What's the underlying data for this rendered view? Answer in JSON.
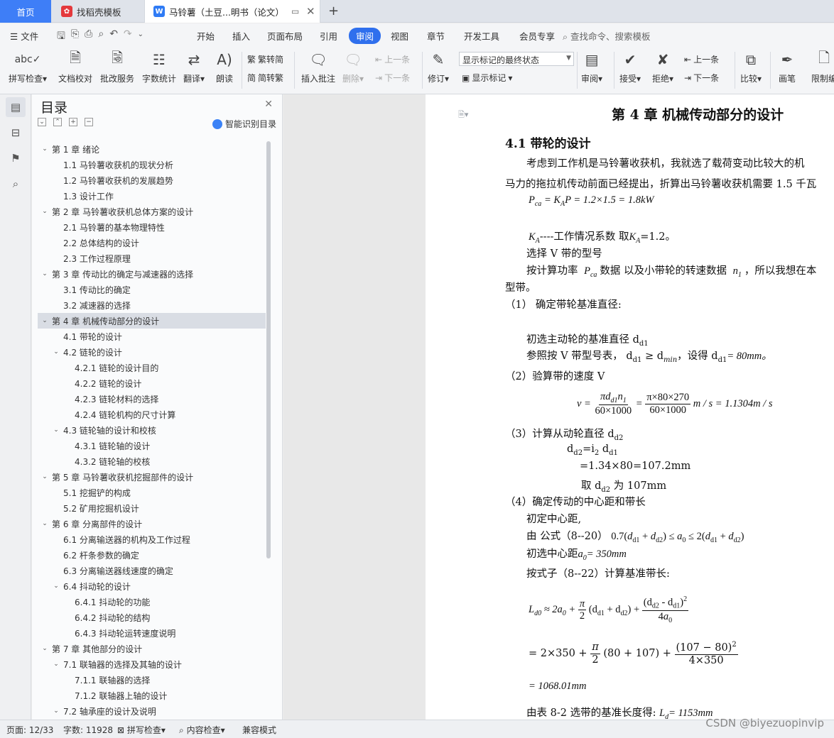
{
  "tabs": {
    "home": "首页",
    "template": "找稻壳模板",
    "document": "马铃薯（土豆...明书（论文）"
  },
  "menu": {
    "file": "文件",
    "items": [
      "开始",
      "插入",
      "页面布局",
      "引用",
      "审阅",
      "视图",
      "章节",
      "开发工具",
      "会员专享"
    ],
    "active": "审阅",
    "search": "查找命令、搜索模板"
  },
  "ribbon": {
    "spell_check": "拼写检查",
    "doc_proof": "文档校对",
    "annotate_service": "批改服务",
    "word_count": "字数统计",
    "translate": "翻译",
    "read_aloud": "朗读",
    "trad_simp": "繁转简",
    "simp_trad": "简转繁",
    "insert_comment": "插入批注",
    "delete": "删除",
    "prev": "上一条",
    "next": "下一条",
    "track": "修订",
    "markup_select": "显示标记的最终状态",
    "show_markup": "显示标记",
    "review": "审阅",
    "accept": "接受",
    "reject": "拒绝",
    "prev2": "上一条",
    "next2": "下一条",
    "compare": "比较",
    "pen": "画笔",
    "restrict": "限制编"
  },
  "outline": {
    "title": "目录",
    "smart": "智能识别目录",
    "items": [
      {
        "label": "第 1 章  绪论",
        "level": 1,
        "chev": "v"
      },
      {
        "label": "1.1 马铃薯收获机的现状分析",
        "level": 2,
        "chev": ""
      },
      {
        "label": "1.2  马铃薯收获机的发展趋势",
        "level": 2,
        "chev": ""
      },
      {
        "label": "1.3 设计工作",
        "level": 2,
        "chev": ""
      },
      {
        "label": "第 2 章   马铃薯收获机总体方案的设计",
        "level": 1,
        "chev": "v"
      },
      {
        "label": "2.1  马铃薯的基本物理特性",
        "level": 2,
        "chev": ""
      },
      {
        "label": "2.2  总体结构的设计",
        "level": 2,
        "chev": ""
      },
      {
        "label": "2.3  工作过程原理",
        "level": 2,
        "chev": ""
      },
      {
        "label": "第 3 章    传动比的确定与减速器的选择",
        "level": 1,
        "chev": "v"
      },
      {
        "label": "3.1  传动比的确定",
        "level": 2,
        "chev": ""
      },
      {
        "label": "3.2  减速器的选择",
        "level": 2,
        "chev": ""
      },
      {
        "label": "第 4 章  机械传动部分的设计",
        "level": 1,
        "chev": "v",
        "selected": true
      },
      {
        "label": "4.1  带轮的设计",
        "level": 2,
        "chev": ""
      },
      {
        "label": "4.2  链轮的设计",
        "level": 2,
        "chev": "v"
      },
      {
        "label": "4.2.1  链轮的设计目的",
        "level": 3,
        "chev": ""
      },
      {
        "label": "4.2.2  链轮的设计",
        "level": 3,
        "chev": ""
      },
      {
        "label": "4.2.3  链轮材料的选择",
        "level": 3,
        "chev": ""
      },
      {
        "label": "4.2.4  链轮机构的尺寸计算",
        "level": 3,
        "chev": ""
      },
      {
        "label": "4.3 链轮轴的设计和校核",
        "level": 2,
        "chev": "v"
      },
      {
        "label": "4.3.1  链轮轴的设计",
        "level": 3,
        "chev": ""
      },
      {
        "label": "4.3.2  链轮轴的校核",
        "level": 3,
        "chev": ""
      },
      {
        "label": "第 5 章  马铃薯收获机挖掘部件的设计",
        "level": 1,
        "chev": "v"
      },
      {
        "label": "5.1  挖掘铲的构成",
        "level": 2,
        "chev": ""
      },
      {
        "label": "5.2  矿用挖掘机设计",
        "level": 2,
        "chev": ""
      },
      {
        "label": "第 6 章  分离部件的设计",
        "level": 1,
        "chev": "v"
      },
      {
        "label": "6.1  分离输送器的机构及工作过程",
        "level": 2,
        "chev": ""
      },
      {
        "label": "6.2  杆条参数的确定",
        "level": 2,
        "chev": ""
      },
      {
        "label": "6.3  分离输送器线速度的确定",
        "level": 2,
        "chev": ""
      },
      {
        "label": "6.4  抖动轮的设计",
        "level": 2,
        "chev": "v"
      },
      {
        "label": "6.4.1  抖动轮的功能",
        "level": 3,
        "chev": ""
      },
      {
        "label": "6.4.2  抖动轮的结构",
        "level": 3,
        "chev": ""
      },
      {
        "label": "6.4.3  抖动轮运转速度说明",
        "level": 3,
        "chev": ""
      },
      {
        "label": "第 7 章  其他部分的设计",
        "level": 1,
        "chev": "v"
      },
      {
        "label": "7.1 联轴器的选择及其轴的设计",
        "level": 2,
        "chev": "v"
      },
      {
        "label": "7.1.1  联轴器的选择",
        "level": 3,
        "chev": ""
      },
      {
        "label": "7.1.2  联轴器上轴的设计",
        "level": 3,
        "chev": ""
      },
      {
        "label": "7.2  轴承座的设计及说明",
        "level": 2,
        "chev": "v"
      }
    ]
  },
  "doc": {
    "chapter": "第 4 章  机械传动部分的设计",
    "section": "4.1  带轮的设计",
    "p1": "考虑到工作机是马铃薯收获机，我就选了载荷变动比较大的机",
    "p2": "马力的拖拉机传动前面已经提出，折算出马铃薯收获机需要 1.5 千瓦",
    "eq1": "P_ca = K_A P = 1.2×1.5 = 1.8kW",
    "ka_line": "----工作情况系数  取",
    "ka_val": "=1.2。",
    "v_select": "选择 V 带的型号",
    "calc_a": "按计算功率",
    "calc_b": "数据  以及小带轮的转速数据",
    "calc_c": "，所以我想在本",
    "belt_type": "型带。",
    "step1": "（1）  确定带轮基准直径:",
    "choose_d": "初选主动轮的基准直径 d",
    "ref_a": "参照按 V 带型号表，",
    "ref_b": "，设得",
    "ref_c": "= 80mm。",
    "step2": "（2）验算带的速度 V",
    "step3": "（3）计算从动轮直径 d",
    "d2_a": "=i",
    "d2_b": "=1.34×80=107.2mm",
    "d2_c": "取 d",
    "d2_d": "为 107mm",
    "step4": "（4）确定传动的中心距和带长",
    "init_a0": "初定中心距,",
    "by_formula": "由  公式（8--20）",
    "choose_a0": "初选中心距",
    "a0_val": "= 350mm",
    "calc_ld": "按式子（8--22）计算基准带长:",
    "result": "= 1068.01mm",
    "table_a": "由表 8-2 选带的基准长度得:",
    "table_b": "= 1153mm"
  },
  "status": {
    "page": "页面: 12/33",
    "words": "字数: 11928",
    "spell": "拼写检查",
    "content": "内容检查",
    "compat": "兼容模式"
  },
  "watermark": "CSDN @biyezuopinvip"
}
